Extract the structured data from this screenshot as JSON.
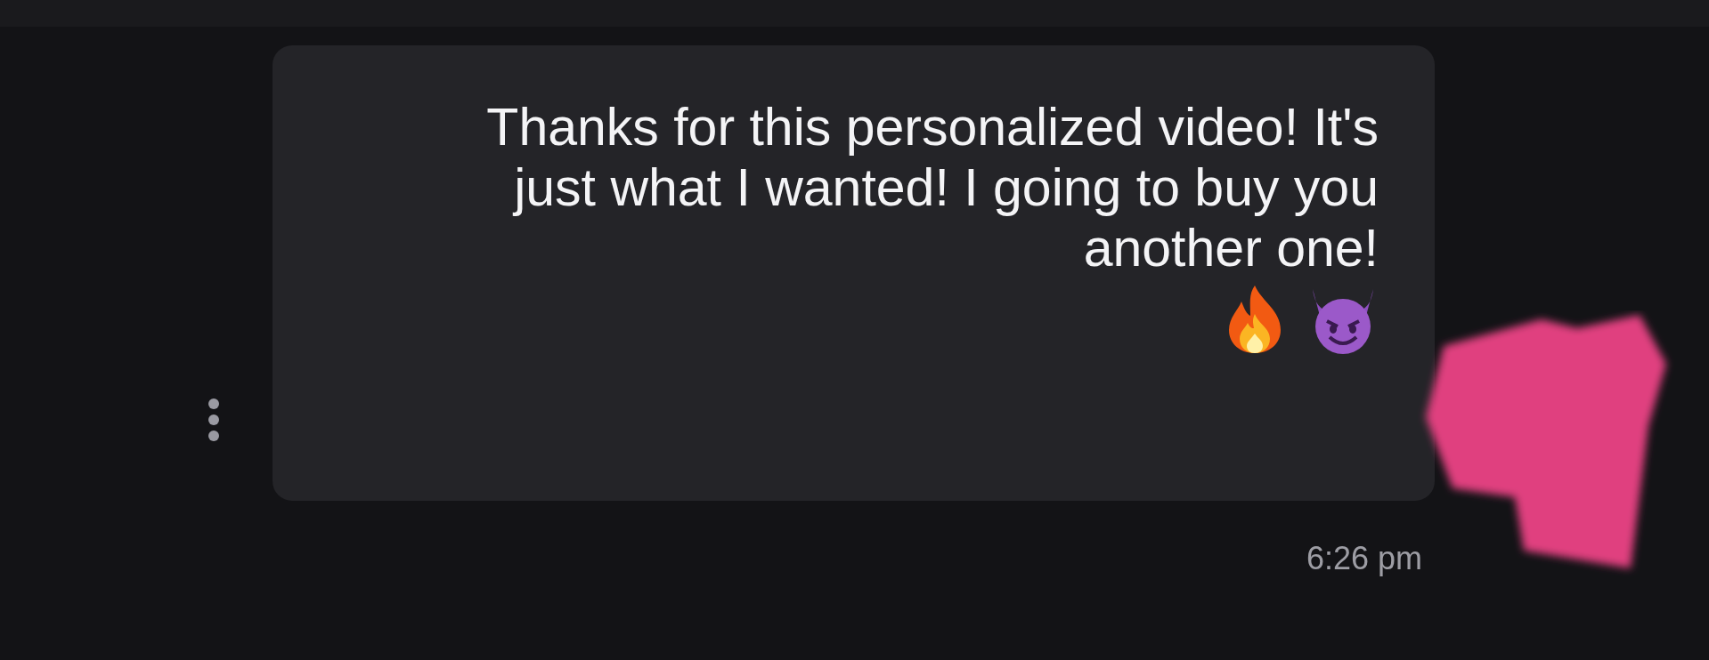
{
  "message": {
    "text": "Thanks for this personalized video! It's just what I wanted! I going to buy you another one!",
    "time": "6:26 pm"
  }
}
